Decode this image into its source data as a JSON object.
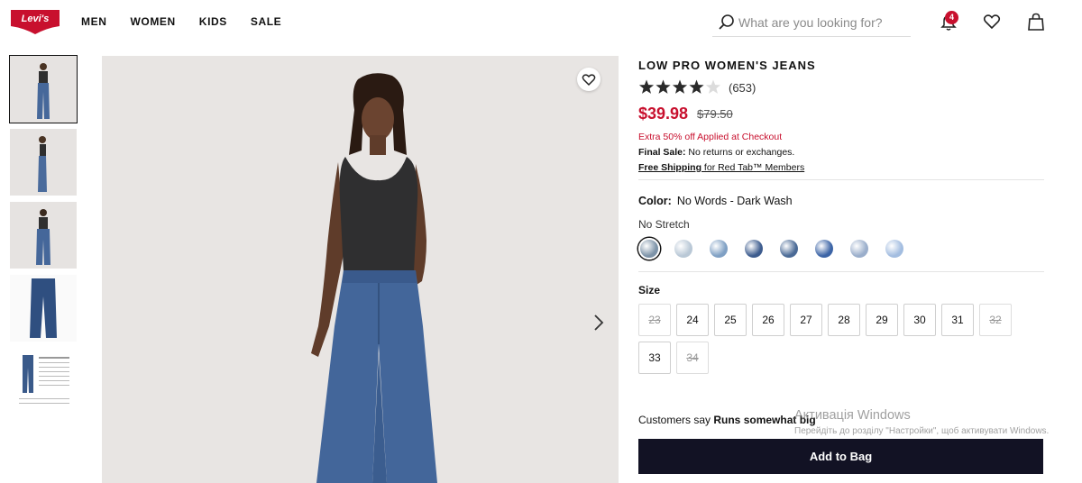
{
  "header": {
    "logo_text": "Levi's",
    "nav": [
      "MEN",
      "WOMEN",
      "KIDS",
      "SALE"
    ],
    "search_placeholder": "What are you looking for?",
    "notifications_count": "4"
  },
  "product": {
    "title": "LOW PRO WOMEN'S JEANS",
    "rating": 4,
    "rating_max": 5,
    "reviews": "(653)",
    "sale_price": "$39.98",
    "original_price": "$79.50",
    "promo": "Extra 50% off Applied at Checkout",
    "final_sale_label": "Final Sale:",
    "final_sale_text": " No returns or exchanges.",
    "shipping_link": "Free Shipping",
    "shipping_mid": " for Red Tab",
    "shipping_members": "™ Members",
    "color_label": "Color:",
    "color_value": "No Words - Dark Wash",
    "stretch": "No Stretch",
    "swatches": [
      "#7d93a8",
      "#b9c8d6",
      "#7fa0c4",
      "#3d5c8e",
      "#4a6a96",
      "#3c64a6",
      "#9aaecb",
      "#a3bde0"
    ],
    "size_label": "Size",
    "sizes": [
      {
        "label": "23",
        "available": false
      },
      {
        "label": "24",
        "available": true
      },
      {
        "label": "25",
        "available": true
      },
      {
        "label": "26",
        "available": true
      },
      {
        "label": "27",
        "available": true
      },
      {
        "label": "28",
        "available": true
      },
      {
        "label": "29",
        "available": true
      },
      {
        "label": "30",
        "available": true
      },
      {
        "label": "31",
        "available": true
      },
      {
        "label": "32",
        "available": false
      },
      {
        "label": "33",
        "available": true
      },
      {
        "label": "34",
        "available": false
      }
    ],
    "fit_prefix": "Customers say ",
    "fit_value": "Runs somewhat big",
    "add_to_bag": "Add to Bag"
  },
  "overlay": {
    "watermark_title": "Активація Windows",
    "watermark_sub": "Перейдіть до розділу \"Настройки\", щоб активувати Windows."
  },
  "colors": {
    "accent_red": "#c8102e",
    "button_dark": "#121224"
  }
}
